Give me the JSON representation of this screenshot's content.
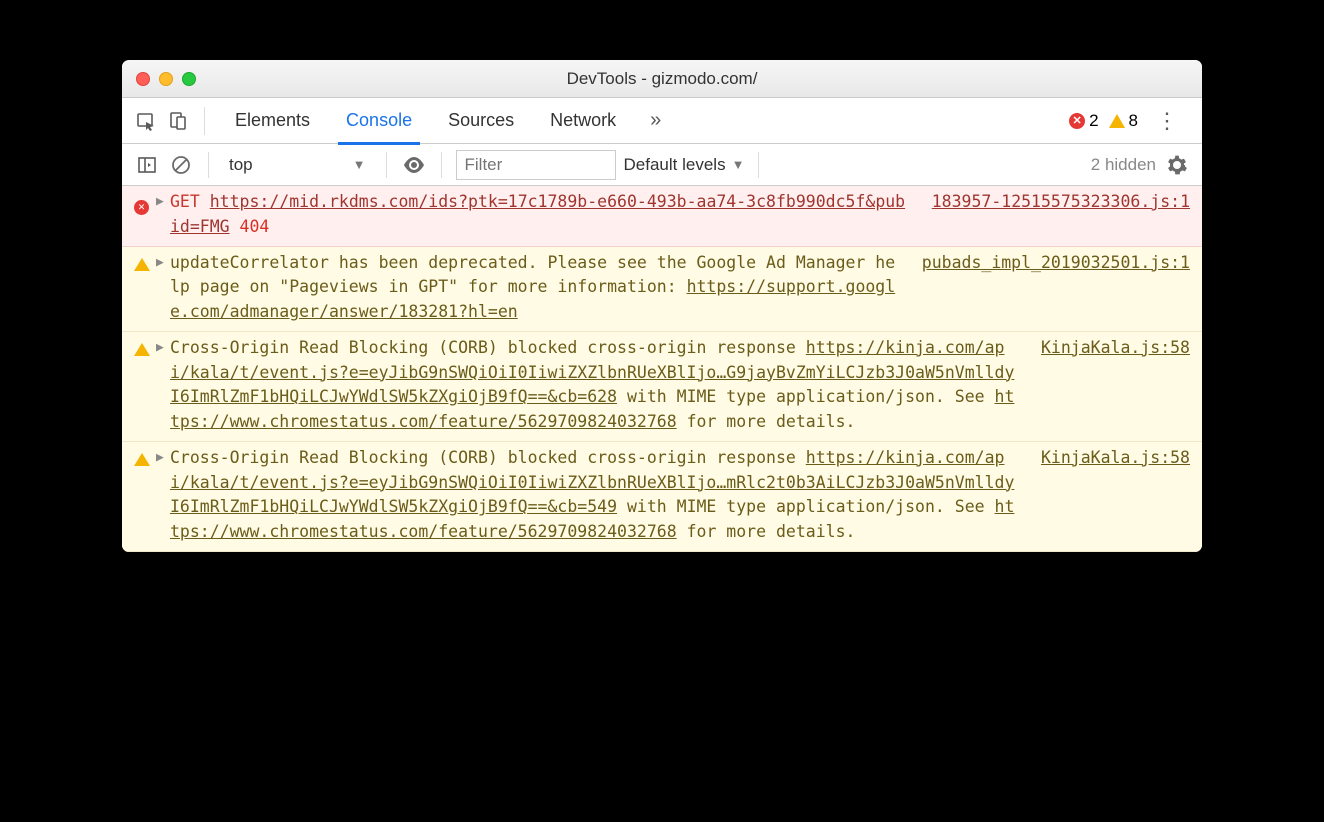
{
  "window": {
    "title": "DevTools - gizmodo.com/"
  },
  "tabs": {
    "items": [
      "Elements",
      "Console",
      "Sources",
      "Network"
    ],
    "active_index": 1,
    "more_glyph": "»"
  },
  "counts": {
    "errors": "2",
    "warnings": "8"
  },
  "filterbar": {
    "context": "top",
    "filter_placeholder": "Filter",
    "levels": "Default levels",
    "hidden": "2 hidden"
  },
  "messages": [
    {
      "type": "error",
      "source": "183957-12515575323306.js:1",
      "method": "GET",
      "url": "https://mid.rkdms.com/ids?ptk=17c1789b-e660-493b-aa74-3c8fb990dc5f&pubid=FMG",
      "status": "404"
    },
    {
      "type": "warning",
      "source": "pubads_impl_2019032501.js:1",
      "text_pre": "updateCorrelator has been deprecated. Please see the Google Ad Manager help page on \"Pageviews in GPT\" for more information: ",
      "link": "https://support.google.com/admanager/answer/183281?hl=en"
    },
    {
      "type": "warning",
      "source": "KinjaKala.js:58",
      "text_pre": "Cross-Origin Read Blocking (CORB) blocked cross-origin response ",
      "link": "https://kinja.com/api/kala/t/event.js?e=eyJibG9nSWQiOiI0IiwiZXZlbnRUeXBlIjo…G9jayBvZmYiLCJzb3J0aW5nVmlldyI6ImRlZmF1bHQiLCJwYWdlSW5kZXgiOjB9fQ==&cb=628",
      "text_mid": " with MIME type application/json. See ",
      "link2": "https://www.chromestatus.com/feature/5629709824032768",
      "text_post": " for more details."
    },
    {
      "type": "warning",
      "source": "KinjaKala.js:58",
      "text_pre": "Cross-Origin Read Blocking (CORB) blocked cross-origin response ",
      "link": "https://kinja.com/api/kala/t/event.js?e=eyJibG9nSWQiOiI0IiwiZXZlbnRUeXBlIjo…mRlc2t0b3AiLCJzb3J0aW5nVmlldyI6ImRlZmF1bHQiLCJwYWdlSW5kZXgiOjB9fQ==&cb=549",
      "text_mid": " with MIME type application/json. See ",
      "link2": "https://www.chromestatus.com/feature/5629709824032768",
      "text_post": " for more details."
    }
  ]
}
